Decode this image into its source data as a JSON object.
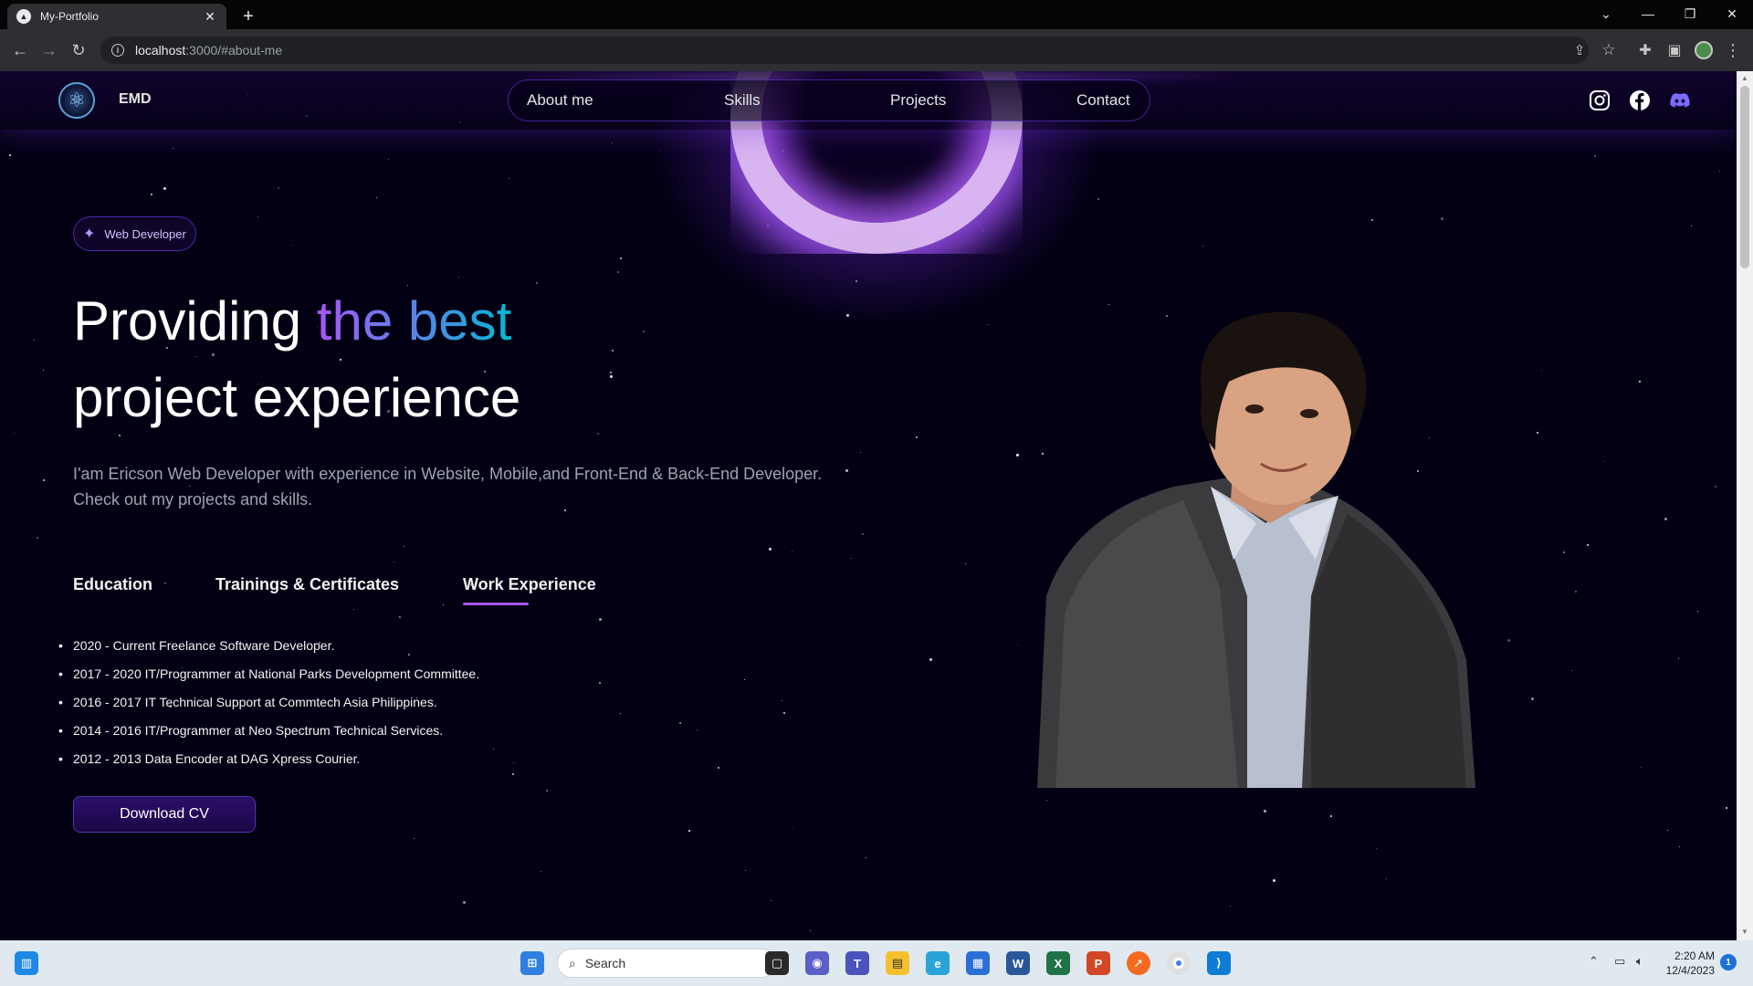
{
  "browser": {
    "tab_title": "My-Portfolio",
    "url_host": "localhost",
    "url_path": ":3000/#about-me"
  },
  "site": {
    "brand": "EMD",
    "nav": [
      "About me",
      "Skills",
      "Projects",
      "Contact"
    ],
    "socials": [
      "instagram-icon",
      "facebook-icon",
      "discord-icon"
    ]
  },
  "hero": {
    "badge": "Web Developer",
    "title_part1": "Providing ",
    "title_highlight": "the best",
    "title_part2": "project experience",
    "description_line1": "I'am Ericson Web Developer with experience in Website, Mobile,and Front-End & Back-End Developer.",
    "description_line2": "Check out my projects and skills."
  },
  "tabs": {
    "items": [
      "Education",
      "Trainings & Certificates",
      "Work Experience"
    ],
    "active": "Work Experience"
  },
  "experience": [
    "2020 - Current Freelance Software Developer.",
    "2017 - 2020  IT/Programmer at National Parks Development Committee.",
    "2016 - 2017  IT Technical Support at Commtech Asia Philippines.",
    "2014 - 2016   IT/Programmer at Neo Spectrum Technical Services.",
    "2012 - 2013   Data Encoder at DAG Xpress Courier."
  ],
  "download_label": "Download CV",
  "taskbar": {
    "search_label": "Search",
    "time": "2:20 AM",
    "date": "12/4/2023",
    "notification_count": "1"
  },
  "colors": {
    "page_bg": "#030014",
    "accent_purple": "#a855f7",
    "accent_cyan": "#06b6d4"
  }
}
